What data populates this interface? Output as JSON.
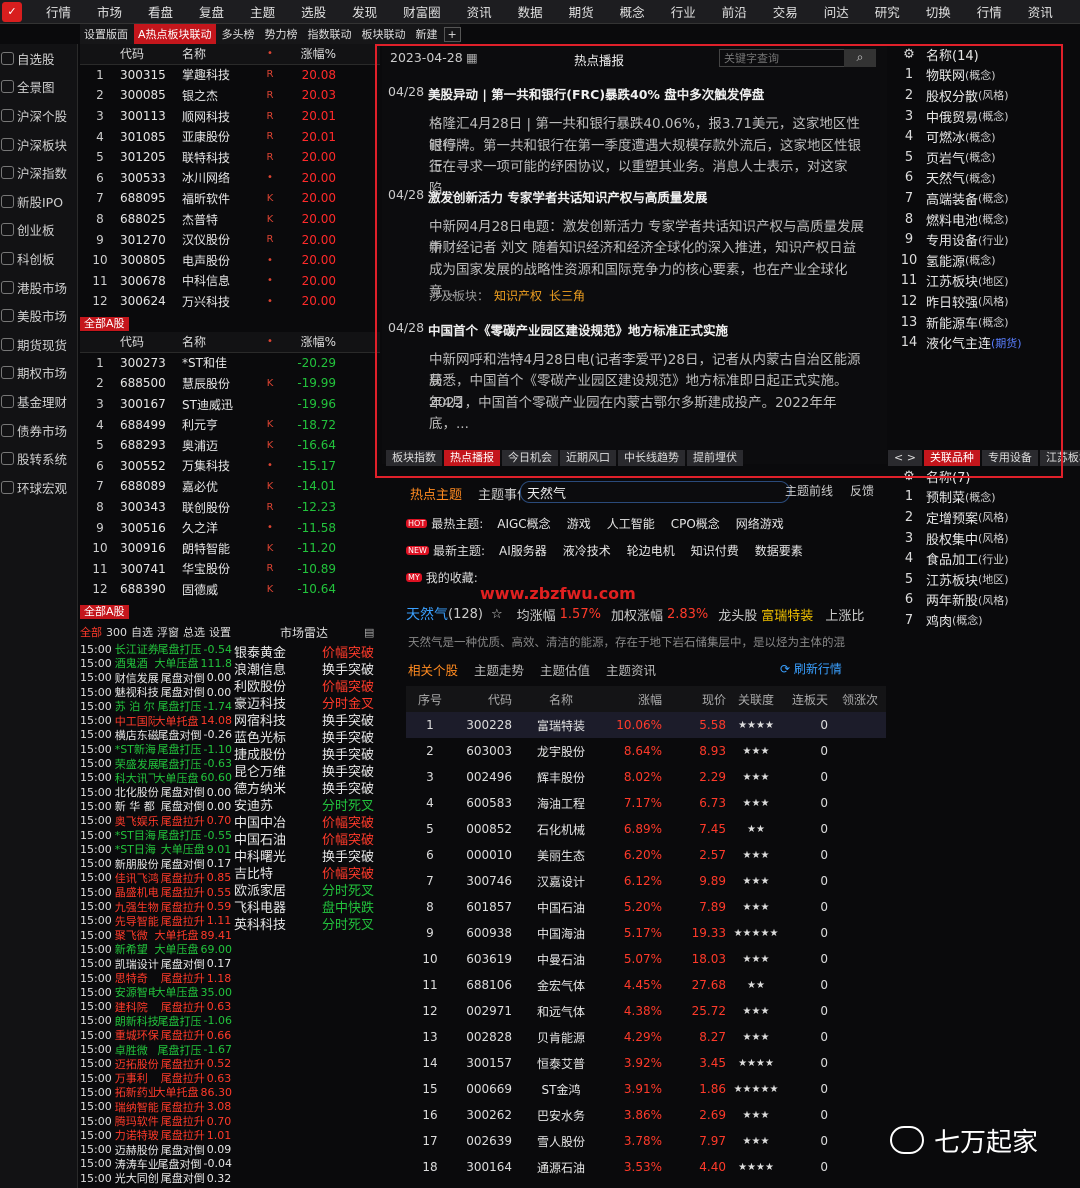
{
  "topmenu": [
    "行情",
    "市场",
    "看盘",
    "复盘",
    "主题",
    "选股",
    "发现",
    "财富圈",
    "资讯",
    "数据",
    "期货",
    "概念",
    "行业",
    "前沿",
    "交易",
    "问达",
    "研究",
    "切换",
    "行情",
    "资讯"
  ],
  "leftnav": [
    "自选股",
    "全景图",
    "沪深个股",
    "沪深板块",
    "沪深指数",
    "新股IPO",
    "创业板",
    "科创板",
    "港股市场",
    "美股市场",
    "期货现货",
    "期权市场",
    "基金理财",
    "债券市场",
    "股转系统",
    "环球宏观"
  ],
  "subtabs": [
    "设置版面",
    "A热点板块联动",
    "多头榜",
    "势力榜",
    "指数联动",
    "板块联动",
    "新建"
  ],
  "grid1": {
    "headers": [
      "代码",
      "名称",
      "涨幅%"
    ],
    "rows": [
      [
        "1",
        "300315",
        "掌趣科技",
        "R",
        "20.08"
      ],
      [
        "2",
        "300085",
        "银之杰",
        "R",
        "20.03"
      ],
      [
        "3",
        "300113",
        "顺网科技",
        "R",
        "20.01"
      ],
      [
        "4",
        "301085",
        "亚康股份",
        "R",
        "20.01"
      ],
      [
        "5",
        "301205",
        "联特科技",
        "R",
        "20.00"
      ],
      [
        "6",
        "300533",
        "冰川网络",
        "•",
        "20.00"
      ],
      [
        "7",
        "688095",
        "福昕软件",
        "K",
        "20.00"
      ],
      [
        "8",
        "688025",
        "杰普特",
        "K",
        "20.00"
      ],
      [
        "9",
        "301270",
        "汉仪股份",
        "R",
        "20.00"
      ],
      [
        "10",
        "300805",
        "电声股份",
        "•",
        "20.00"
      ],
      [
        "11",
        "300678",
        "中科信息",
        "•",
        "20.00"
      ],
      [
        "12",
        "300624",
        "万兴科技",
        "•",
        "20.00"
      ]
    ]
  },
  "tag_all1": "全部A股",
  "grid2": {
    "headers": [
      "代码",
      "名称",
      "涨幅%"
    ],
    "rows": [
      [
        "1",
        "300273",
        "*ST和佳",
        "",
        "-20.29"
      ],
      [
        "2",
        "688500",
        "慧辰股份",
        "K",
        "-19.99"
      ],
      [
        "3",
        "300167",
        "ST迪威迅",
        "",
        "-19.96"
      ],
      [
        "4",
        "688499",
        "利元亨",
        "K",
        "-18.72"
      ],
      [
        "5",
        "688293",
        "奥浦迈",
        "K",
        "-16.64"
      ],
      [
        "6",
        "300552",
        "万集科技",
        "•",
        "-15.17"
      ],
      [
        "7",
        "688089",
        "嘉必优",
        "K",
        "-14.01"
      ],
      [
        "8",
        "300343",
        "联创股份",
        "R",
        "-12.23"
      ],
      [
        "9",
        "300516",
        "久之洋",
        "•",
        "-11.58"
      ],
      [
        "10",
        "300916",
        "朗特智能",
        "K",
        "-11.20"
      ],
      [
        "11",
        "300741",
        "华宝股份",
        "R",
        "-10.89"
      ],
      [
        "12",
        "688390",
        "固德威",
        "K",
        "-10.64"
      ]
    ]
  },
  "tag_all2": "全部A股",
  "news": {
    "date": "2023-04-28",
    "title": "热点播报",
    "search_placeholder": "关键字查询",
    "items": [
      {
        "d": "04/28",
        "h": "美股异动 | 第一共和银行(FRC)暴跌40% 盘中多次触发停盘",
        "body": [
          "格隆汇4月28日 | 第一共和银行暴跌40.06%，报3.71美元，这家地区性银行",
          "时停牌。第一共和银行在第一季度遭遇大规模存款外流后，这家地区性银行",
          "正在寻求一项可能的纾困协议，以重塑其业务。消息人士表示，对这家陷..."
        ]
      },
      {
        "d": "04/28",
        "h": "激发创新活力 专家学者共话知识产权与高质量发展",
        "body": [
          "中新网4月28日电题：激发创新活力 专家学者共话知识产权与高质量发展 中",
          "新财经记者 刘文 随着知识经济和经济全球化的深入推进，知识产权日益",
          "成为国家发展的战略性资源和国际竞争力的核心要素，也在产业全球化竞..."
        ],
        "rel": "涉及板块：",
        "rel_items": [
          "知识产权",
          "长三角"
        ]
      },
      {
        "d": "04/28",
        "h": "中国首个《零碳产业园区建设规范》地方标准正式实施",
        "body": [
          "中新网呼和浩特4月28日电(记者李爱平)28日，记者从内蒙古自治区能源局",
          "获悉，中国首个《零碳产业园区建设规范》地方标准即日起正式实施。2022",
          "年4月，中国首个零碳产业园在内蒙古鄂尔多斯建成投产。2022年年底，..."
        ]
      }
    ]
  },
  "btmtabs": [
    "板块指数",
    "热点播报",
    "今日机会",
    "近期风口",
    "中长线趋势",
    "提前埋伏"
  ],
  "right_top": {
    "header": "名称(14)",
    "rows": [
      [
        "1",
        "物联网",
        "(概念)"
      ],
      [
        "2",
        "股权分散",
        "(风格)"
      ],
      [
        "3",
        "中俄贸易",
        "(概念)"
      ],
      [
        "4",
        "可燃冰",
        "(概念)"
      ],
      [
        "5",
        "页岩气",
        "(概念)"
      ],
      [
        "6",
        "天然气",
        "(概念)"
      ],
      [
        "7",
        "高端装备",
        "(概念)"
      ],
      [
        "8",
        "燃料电池",
        "(概念)"
      ],
      [
        "9",
        "专用设备",
        "(行业)"
      ],
      [
        "10",
        "氢能源",
        "(概念)"
      ],
      [
        "11",
        "江苏板块",
        "(地区)"
      ],
      [
        "12",
        "昨日较强",
        "(风格)"
      ],
      [
        "13",
        "新能源车",
        "(概念)"
      ],
      [
        "14",
        "液化气主连",
        "(期货)"
      ]
    ]
  },
  "right_tabs": [
    "关联品种",
    "专用设备",
    "江苏板块"
  ],
  "right_bot": {
    "header": "名称(7)",
    "rows": [
      [
        "1",
        "预制菜",
        "(概念)"
      ],
      [
        "2",
        "定增预案",
        "(风格)"
      ],
      [
        "3",
        "股权集中",
        "(风格)"
      ],
      [
        "4",
        "食品加工",
        "(行业)"
      ],
      [
        "5",
        "江苏板块",
        "(地区)"
      ],
      [
        "6",
        "两年新股",
        "(风格)"
      ],
      [
        "7",
        "鸡肉",
        "(概念)"
      ]
    ]
  },
  "hot": {
    "tabs": [
      "热点主题",
      "主题事件"
    ],
    "search_value": "天然气",
    "right_links": [
      "主题前线",
      "反馈"
    ],
    "hot_label": "最热主题:",
    "hot_items": [
      "AIGC概念",
      "游戏",
      "人工智能",
      "CPO概念",
      "网络游戏"
    ],
    "new_label": "最新主题:",
    "new_items": [
      "AI服务器",
      "液冷技术",
      "轮边电机",
      "知识付费",
      "数据要素"
    ],
    "my_label": "我的收藏:",
    "watermark": "www.zbzfwu.com",
    "theme": "天然气",
    "count": "(128)",
    "avg_label": "均涨幅",
    "avg": "1.57%",
    "w_label": "加权涨幅",
    "w": "2.83%",
    "lead_label": "龙头股",
    "lead": "富瑞特装",
    "up_label": "上涨比",
    "desc": "天然气是一种优质、高效、清洁的能源，存在于地下岩石储集层中，是以烃为主体的混",
    "subtabs": [
      "相关个股",
      "主题走势",
      "主题估值",
      "主题资讯"
    ],
    "refresh": "刷新行情"
  },
  "table2": {
    "headers": [
      "序号",
      "代码",
      "名称",
      "涨幅",
      "现价",
      "关联度",
      "连板天",
      "领涨次"
    ],
    "rows": [
      [
        "1",
        "300228",
        "富瑞特装",
        "10.06%",
        "5.58",
        "★★★★",
        "0"
      ],
      [
        "2",
        "603003",
        "龙宇股份",
        "8.64%",
        "8.93",
        "★★★",
        "0"
      ],
      [
        "3",
        "002496",
        "辉丰股份",
        "8.02%",
        "2.29",
        "★★★",
        "0"
      ],
      [
        "4",
        "600583",
        "海油工程",
        "7.17%",
        "6.73",
        "★★★",
        "0"
      ],
      [
        "5",
        "000852",
        "石化机械",
        "6.89%",
        "7.45",
        "★★",
        "0"
      ],
      [
        "6",
        "000010",
        "美丽生态",
        "6.20%",
        "2.57",
        "★★★",
        "0"
      ],
      [
        "7",
        "300746",
        "汉嘉设计",
        "6.12%",
        "9.89",
        "★★★",
        "0"
      ],
      [
        "8",
        "601857",
        "中国石油",
        "5.20%",
        "7.89",
        "★★★",
        "0"
      ],
      [
        "9",
        "600938",
        "中国海油",
        "5.17%",
        "19.33",
        "★★★★★",
        "0"
      ],
      [
        "10",
        "603619",
        "中曼石油",
        "5.07%",
        "18.03",
        "★★★",
        "0"
      ],
      [
        "11",
        "688106",
        "金宏气体",
        "4.45%",
        "27.68",
        "★★",
        "0"
      ],
      [
        "12",
        "002971",
        "和远气体",
        "4.38%",
        "25.72",
        "★★★",
        "0"
      ],
      [
        "13",
        "002828",
        "贝肯能源",
        "4.29%",
        "8.27",
        "★★★",
        "0"
      ],
      [
        "14",
        "300157",
        "恒泰艾普",
        "3.92%",
        "3.45",
        "★★★★",
        "0"
      ],
      [
        "15",
        "000669",
        "ST金鸿",
        "3.91%",
        "1.86",
        "★★★★★",
        "0"
      ],
      [
        "16",
        "300262",
        "巴安水务",
        "3.86%",
        "2.69",
        "★★★",
        "0"
      ],
      [
        "17",
        "002639",
        "雪人股份",
        "3.78%",
        "7.97",
        "★★★",
        "0"
      ],
      [
        "18",
        "300164",
        "通源石油",
        "3.53%",
        "4.40",
        "★★★★",
        "0"
      ]
    ]
  },
  "radar": {
    "tabs": [
      "全部",
      "300",
      "自选",
      "浮窗",
      "总选",
      "设置"
    ],
    "title": "市场雷达",
    "left": [
      [
        "15:00",
        "长江证券",
        "尾盘打压",
        "-0.54",
        "g"
      ],
      [
        "15:00",
        "酒鬼酒",
        "大单压盘",
        "111.8",
        "g"
      ],
      [
        "15:00",
        "财信发展",
        "尾盘对倒",
        "0.00",
        "w"
      ],
      [
        "15:00",
        "魅视科技",
        "尾盘对倒",
        "0.00",
        "w"
      ],
      [
        "15:00",
        "苏 泊 尔",
        "尾盘打压",
        "-1.74",
        "g"
      ],
      [
        "15:00",
        "中工国际",
        "大单托盘",
        "14.08",
        "r"
      ],
      [
        "15:00",
        "横店东磁",
        "尾盘对倒",
        "-0.26",
        "w"
      ],
      [
        "15:00",
        "*ST新海",
        "尾盘打压",
        "-1.10",
        "g"
      ],
      [
        "15:00",
        "荣盛发展",
        "尾盘打压",
        "-0.63",
        "g"
      ],
      [
        "15:00",
        "科大讯飞",
        "大单压盘",
        "60.60",
        "g"
      ],
      [
        "15:00",
        "北化股份",
        "尾盘对倒",
        "0.00",
        "w"
      ],
      [
        "15:00",
        "新 华 都",
        "尾盘对倒",
        "0.00",
        "w"
      ],
      [
        "15:00",
        "奥飞娱乐",
        "尾盘拉升",
        "0.70",
        "r"
      ],
      [
        "15:00",
        "*ST目海",
        "尾盘打压",
        "-0.55",
        "g"
      ],
      [
        "15:00",
        "*ST日海",
        "大单压盘",
        "9.01",
        "g"
      ],
      [
        "15:00",
        "新朋股份",
        "尾盘对倒",
        "0.17",
        "w"
      ],
      [
        "15:00",
        "佳讯飞鸿",
        "尾盘拉升",
        "0.85",
        "r"
      ],
      [
        "15:00",
        "晶盛机电",
        "尾盘拉升",
        "0.55",
        "r"
      ],
      [
        "15:00",
        "九强生物",
        "尾盘拉升",
        "0.59",
        "r"
      ],
      [
        "15:00",
        "先导智能",
        "尾盘拉升",
        "1.11",
        "r"
      ],
      [
        "15:00",
        "聚飞微",
        "大单托盘",
        "89.41",
        "r"
      ],
      [
        "15:00",
        "新希望",
        "大单压盘",
        "69.00",
        "g"
      ],
      [
        "15:00",
        "凯瑞设计",
        "尾盘对倒",
        "0.17",
        "w"
      ],
      [
        "15:00",
        "思特奇",
        "尾盘拉升",
        "1.18",
        "r"
      ],
      [
        "15:00",
        "安源智电",
        "大单压盘",
        "35.00",
        "g"
      ],
      [
        "15:00",
        "建科院",
        "尾盘拉升",
        "0.63",
        "r"
      ],
      [
        "15:00",
        "朗新科技",
        "尾盘打压",
        "-1.06",
        "g"
      ],
      [
        "15:00",
        "重城环保",
        "尾盘拉升",
        "0.66",
        "r"
      ],
      [
        "15:00",
        "卓胜微",
        "尾盘打压",
        "-1.67",
        "g"
      ],
      [
        "15:00",
        "迈拓股份",
        "尾盘拉升",
        "0.52",
        "r"
      ],
      [
        "15:00",
        "万事利",
        "尾盘拉升",
        "0.63",
        "r"
      ],
      [
        "15:00",
        "拓新药业",
        "大单托盘",
        "86.30",
        "r"
      ],
      [
        "15:00",
        "瑞纳智能",
        "尾盘拉升",
        "3.08",
        "r"
      ],
      [
        "15:00",
        "腾玛软件",
        "尾盘拉升",
        "0.70",
        "r"
      ],
      [
        "15:00",
        "力诺特玻",
        "尾盘拉升",
        "1.01",
        "r"
      ],
      [
        "15:00",
        "迈赫股份",
        "尾盘对倒",
        "0.09",
        "w"
      ],
      [
        "15:00",
        "涛涛车业",
        "尾盘对倒",
        "-0.04",
        "w"
      ],
      [
        "15:00",
        "光大同创",
        "尾盘对倒",
        "0.32",
        "w"
      ]
    ],
    "right": [
      [
        "银泰黄金",
        "价幅突破",
        "r"
      ],
      [
        "浪潮信息",
        "换手突破",
        "w"
      ],
      [
        "利欧股份",
        "价幅突破",
        "r"
      ],
      [
        "豪迈科技",
        "分时金叉",
        "r"
      ],
      [
        "网宿科技",
        "换手突破",
        "w"
      ],
      [
        "蓝色光标",
        "换手突破",
        "w"
      ],
      [
        "捷成股份",
        "换手突破",
        "w"
      ],
      [
        "昆仑万维",
        "换手突破",
        "w"
      ],
      [
        "德方纳米",
        "换手突破",
        "w"
      ],
      [
        "安迪苏",
        "分时死叉",
        "g"
      ],
      [
        "中国中冶",
        "价幅突破",
        "r"
      ],
      [
        "中国石油",
        "价幅突破",
        "r"
      ],
      [
        "中科曙光",
        "换手突破",
        "w"
      ],
      [
        "吉比特",
        "价幅突破",
        "r"
      ],
      [
        "欧派家居",
        "分时死叉",
        "g"
      ],
      [
        "飞科电器",
        "盘中快跌",
        "g"
      ],
      [
        "英科科技",
        "分时死叉",
        "g"
      ]
    ]
  },
  "watermark2": "七万起家"
}
